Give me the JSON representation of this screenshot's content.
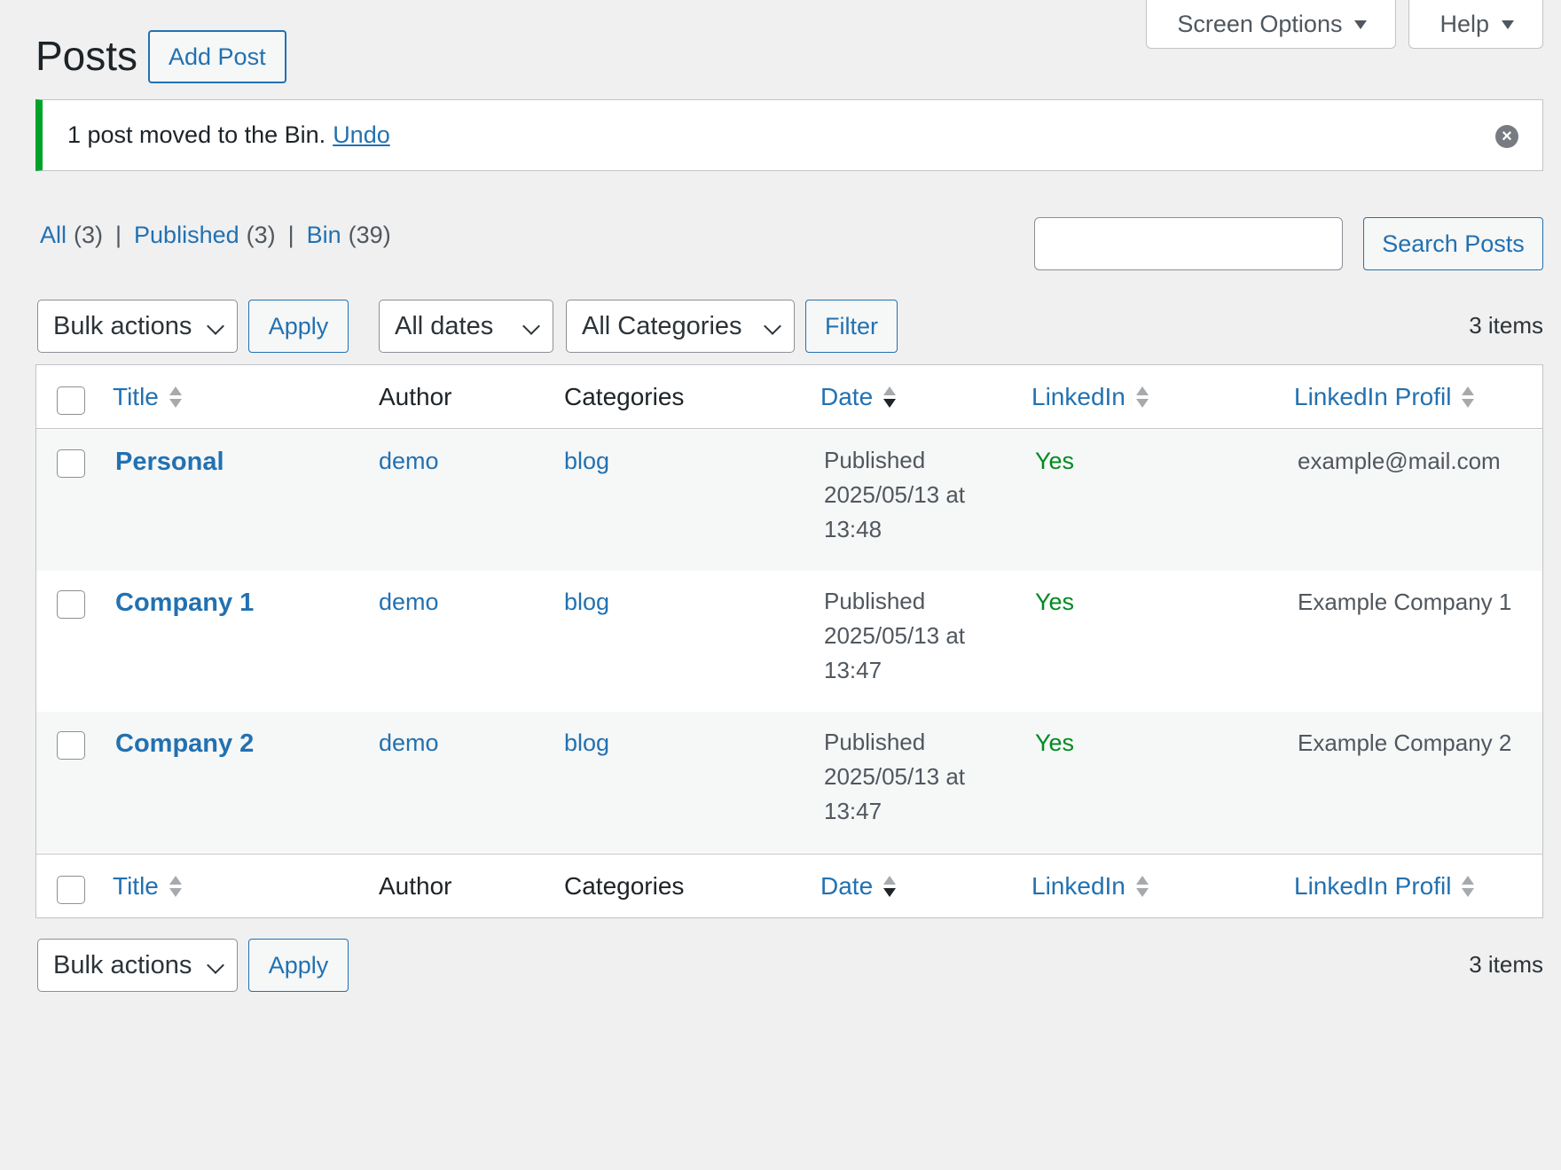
{
  "screen_meta": {
    "screen_options": "Screen Options",
    "help": "Help"
  },
  "header": {
    "title": "Posts",
    "add_button": "Add Post"
  },
  "notice": {
    "message": "1 post moved to the Bin.",
    "undo": "Undo"
  },
  "views": [
    {
      "label": "All",
      "count": "(3)"
    },
    {
      "label": "Published",
      "count": "(3)"
    },
    {
      "label": "Bin",
      "count": "(39)"
    }
  ],
  "views_separator": "|",
  "search": {
    "value": "",
    "button": "Search Posts"
  },
  "tablenav_top": {
    "bulk_actions": "Bulk actions",
    "apply": "Apply",
    "dates": "All dates",
    "categories": "All Categories",
    "filter": "Filter",
    "count": "3 items"
  },
  "columns": {
    "title": "Title",
    "author": "Author",
    "categories": "Categories",
    "date": "Date",
    "linkedin": "LinkedIn",
    "linkedin_profile": "LinkedIn Profil"
  },
  "rows": [
    {
      "title": "Personal",
      "author": "demo",
      "category": "blog",
      "status": "Published",
      "date": "2025/05/13 at",
      "time": "13:48",
      "linkedin": "Yes",
      "profile": "example@mail.com"
    },
    {
      "title": "Company 1",
      "author": "demo",
      "category": "blog",
      "status": "Published",
      "date": "2025/05/13 at",
      "time": "13:47",
      "linkedin": "Yes",
      "profile": "Example Company 1"
    },
    {
      "title": "Company 2",
      "author": "demo",
      "category": "blog",
      "status": "Published",
      "date": "2025/05/13 at",
      "time": "13:47",
      "linkedin": "Yes",
      "profile": "Example Company 2"
    }
  ],
  "tablenav_bottom": {
    "bulk_actions": "Bulk actions",
    "apply": "Apply",
    "count": "3 items"
  },
  "colors": {
    "accent": "#2271b1",
    "success": "#00a32a",
    "yes": "#008a20",
    "background": "#f0f0f1"
  }
}
